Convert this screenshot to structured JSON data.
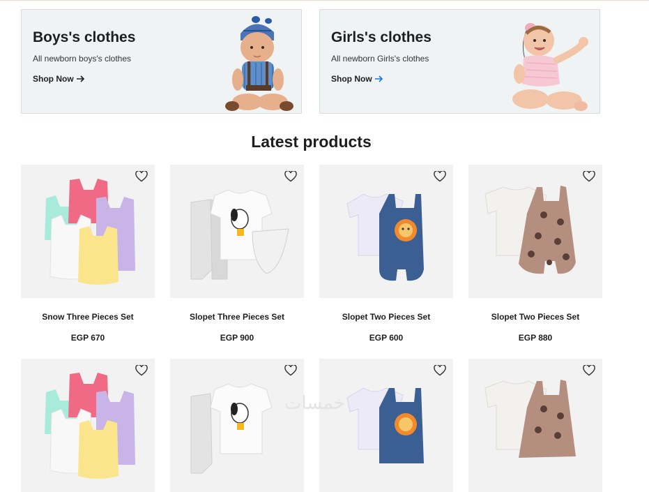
{
  "promos": [
    {
      "title": "Boys's clothes",
      "subtitle": "All newborn boys's clothes",
      "cta": "Shop Now"
    },
    {
      "title": "Girls's clothes",
      "subtitle": "All newborn Girls's clothes",
      "cta": "Shop Now"
    }
  ],
  "colors": {
    "arrow_dark": "#1e1e1e",
    "arrow_blue": "#1a73e8"
  },
  "section_title": "Latest products",
  "products": [
    {
      "name": "Snow Three Pieces Set",
      "price": "EGP 670"
    },
    {
      "name": "Slopet Three Pieces Set",
      "price": "EGP 900"
    },
    {
      "name": "Slopet Two Pieces Set",
      "price": "EGP 600"
    },
    {
      "name": "Slopet Two Pieces Set",
      "price": "EGP 880"
    }
  ],
  "watermark": "خمسات"
}
